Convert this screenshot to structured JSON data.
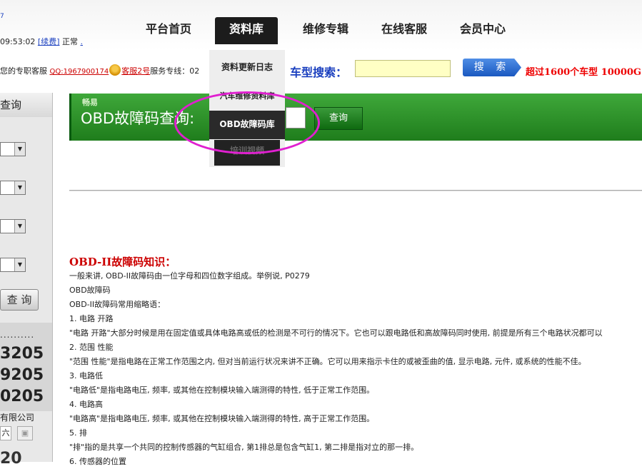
{
  "nav": {
    "home": "平台首页",
    "library": "资料库",
    "repair": "维修专辑",
    "online_service": "在线客服",
    "member": "会员中心"
  },
  "status": {
    "time": "09:53:02",
    "renew": "[续费]",
    "state": "正常"
  },
  "service_line": {
    "prefix": "您的专职客服",
    "qq": "QQ:1967900174",
    "agent": "客服2号",
    "hotline": "服务专线：02"
  },
  "car_search": {
    "label": "车型搜索：",
    "button": "搜 索",
    "promo": "超过1600个车型  10000G"
  },
  "dropdown": {
    "update_log": "资料更新日志",
    "car_repair": "汽车维修资料库",
    "obd": "OBD故障码库",
    "training": "培训视频"
  },
  "left_panel": {
    "header": "查询",
    "query_button": "查 询",
    "dots": "..........",
    "numbers": [
      "3205",
      "9205",
      "0205"
    ],
    "company": "有限公司",
    "weekday": "六",
    "clock": "20"
  },
  "banner": {
    "brand": "畅易",
    "title": "OBD故障码查询:",
    "button": "查询"
  },
  "content": {
    "title": "OBD-II故障码知识：",
    "lines": [
      "一般来讲, OBD-II故障码由一位字母和四位数字组成。举例说, P0279",
      "OBD故障码",
      "OBD-II故障码常用缩略语：",
      "1. 电路 开路",
      "\"电路 开路\"大部分时候是用在固定值或具体电路高或低的检测是不可行的情况下。它也可以跟电路低和高故障码同时使用, 前提是所有三个电路状况都可以",
      "2. 范围 性能",
      "\"范围 性能\"是指电路在正常工作范围之内, 但对当前运行状况来讲不正确。它可以用来指示卡住的或被歪曲的值, 显示电路, 元件, 或系统的性能不佳。",
      "3. 电路低",
      "\"电路低\"是指电路电压, 频率, 或其他在控制模块输入端测得的特性, 低于正常工作范围。",
      "4. 电路高",
      "\"电路高\"是指电路电压, 频率, 或其他在控制模块输入端测得的特性, 高于正常工作范围。",
      "5. 排",
      "\"排\"指的是共享一个共同的控制传感器的气缸组合, 第1排总是包含气缸1, 第二排是指对立的那一排。",
      "6. 传感器的位置"
    ]
  },
  "colors": {
    "highlight": "#e020d0",
    "banner_green": "#2a8f27",
    "title_red": "#cc0000",
    "link_blue": "#1a3fbf"
  }
}
